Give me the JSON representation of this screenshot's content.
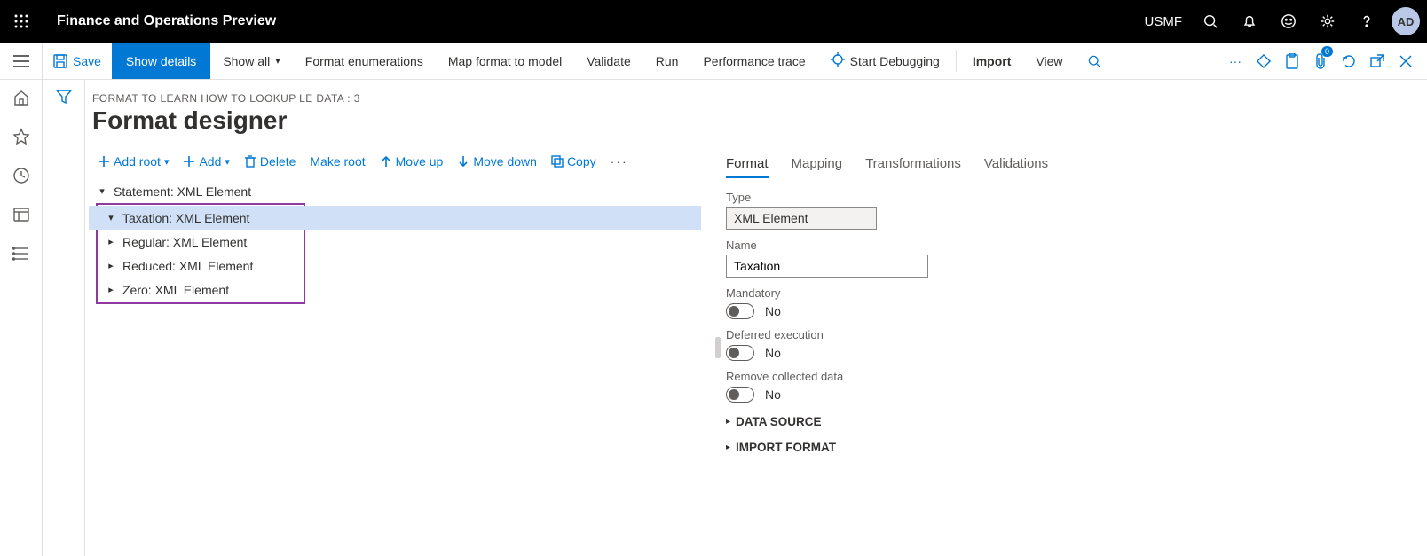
{
  "topbar": {
    "app_title": "Finance and Operations Preview",
    "company": "USMF",
    "avatar": "AD"
  },
  "cmdbar": {
    "save": "Save",
    "show_details": "Show details",
    "show_all": "Show all",
    "format_enum": "Format enumerations",
    "map_format": "Map format to model",
    "validate": "Validate",
    "run": "Run",
    "perf_trace": "Performance trace",
    "start_debug": "Start Debugging",
    "import": "Import",
    "view": "View",
    "badge": "0"
  },
  "page": {
    "breadcrumb": "FORMAT TO LEARN HOW TO LOOKUP LE DATA : 3",
    "title": "Format designer"
  },
  "treetoolbar": {
    "add_root": "Add root",
    "add": "Add",
    "delete": "Delete",
    "make_root": "Make root",
    "move_up": "Move up",
    "move_down": "Move down",
    "copy": "Copy"
  },
  "tree": {
    "root": "Statement: XML Element",
    "taxation": "Taxation: XML Element",
    "regular": "Regular: XML Element",
    "reduced": "Reduced: XML Element",
    "zero": "Zero: XML Element"
  },
  "tabs": {
    "format": "Format",
    "mapping": "Mapping",
    "transformations": "Transformations",
    "validations": "Validations"
  },
  "props": {
    "type_label": "Type",
    "type_value": "XML Element",
    "name_label": "Name",
    "name_value": "Taxation",
    "mandatory_label": "Mandatory",
    "mandatory_value": "No",
    "deferred_label": "Deferred execution",
    "deferred_value": "No",
    "remove_label": "Remove collected data",
    "remove_value": "No",
    "data_source": "DATA SOURCE",
    "import_format": "IMPORT FORMAT"
  }
}
